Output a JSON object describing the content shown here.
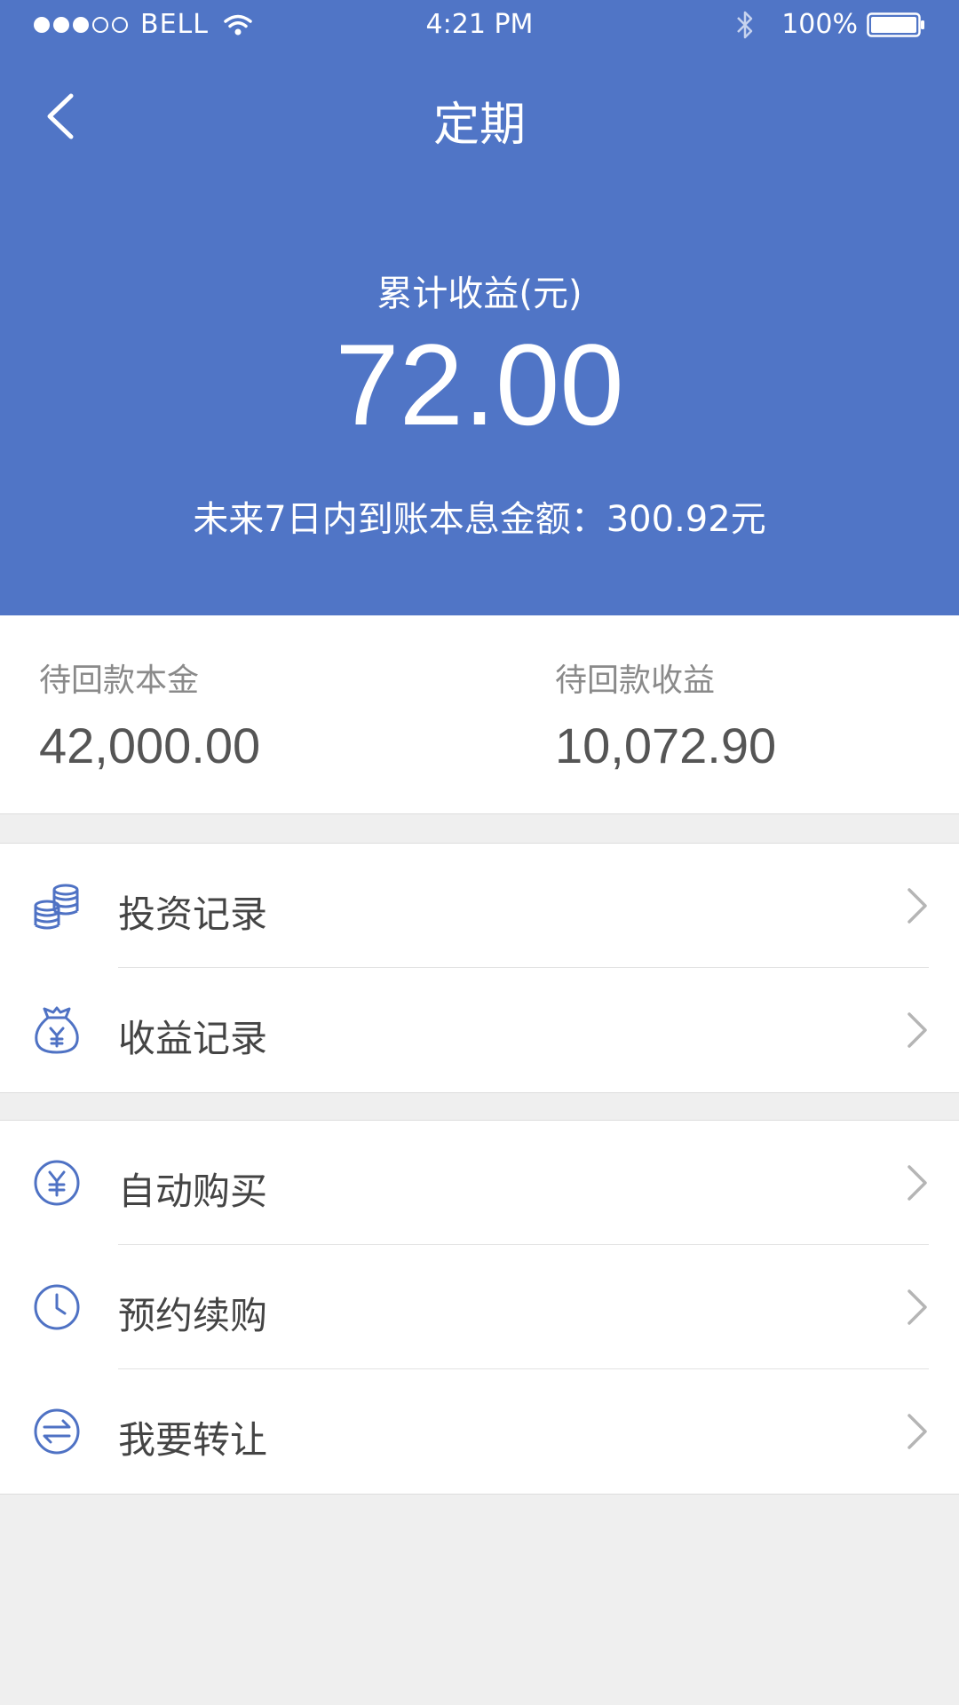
{
  "status_bar": {
    "carrier": "BELL",
    "time": "4:21 PM",
    "battery": "100%"
  },
  "nav": {
    "title": "定期"
  },
  "summary": {
    "label": "累计收益(元)",
    "value": "72.00",
    "note": "未来7日内到账本息金额：300.92元"
  },
  "stats": [
    {
      "label": "待回款本金",
      "value": "42,000.00"
    },
    {
      "label": "待回款收益",
      "value": "10,072.90"
    }
  ],
  "menu_group_1": [
    {
      "label": "投资记录",
      "icon": "coins-icon"
    },
    {
      "label": "收益记录",
      "icon": "money-bag-icon"
    }
  ],
  "menu_group_2": [
    {
      "label": "自动购买",
      "icon": "yuan-circle-icon"
    },
    {
      "label": "预约续购",
      "icon": "clock-icon"
    },
    {
      "label": "我要转让",
      "icon": "transfer-icon"
    }
  ],
  "colors": {
    "primary": "#5075c6",
    "icon": "#4f72c4",
    "chevron": "#b5b5b5"
  }
}
